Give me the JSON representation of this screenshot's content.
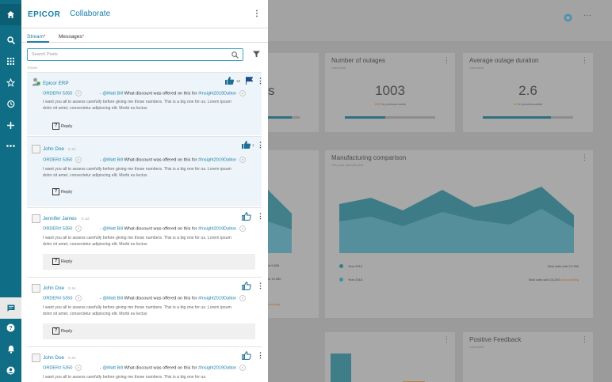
{
  "header": {
    "brand": "EPICOR",
    "title": "Collaborate"
  },
  "tabs": [
    {
      "label": "Stream",
      "marker": "*"
    },
    {
      "label": "Messages",
      "marker": "*"
    }
  ],
  "search": {
    "placeholder": "Search Posts"
  },
  "today_label": "TODAY",
  "rail": {
    "top": [
      "home-icon",
      "search-icon",
      "apps-icon",
      "star-icon",
      "history-icon",
      "plus-icon",
      "more-icon"
    ],
    "bottom": [
      "chat-icon",
      "help-icon",
      "bell-icon",
      "account-icon"
    ]
  },
  "posts": [
    {
      "author": "Epicor ERP",
      "date": "",
      "order": "ORDER# 5350",
      "mention": "@Matt Bill",
      "message": "What discount was offered on this for",
      "tag": "#Insight2019Dalton",
      "body": "I want you all to assess carefully before giving me those numbers. This is a big one for us. Lorem ipsum dolor sit amet, consectetur adipiscing elit. Morbi eu lectus",
      "reply": "Reply",
      "likes": "19",
      "liked": true,
      "flagged": true
    },
    {
      "author": "John Doe",
      "date": "9 Jul",
      "order": "ORDER# 5350",
      "mention": "@Matt Bill",
      "message": "What discount was offered on this for",
      "tag": "#Insight2019Dalton",
      "body": "I want you all to assess carefully before giving me those numbers. This is a big one for us. Lorem ipsum dolor sit amet, consectetur adipiscing elit. Morbi eu lectus",
      "reply": "Reply",
      "likes": "1",
      "liked": true,
      "flagged": false
    },
    {
      "author": "Jennifer James",
      "date": "9 Jul",
      "order": "ORDER# 5350",
      "mention": "@Matt Bill",
      "message": "What discount was offered on this for",
      "tag": "#Insight2019Dalton",
      "body": "I want you all to assess carefully before giving me those numbers. This is a big one for us. Lorem ipsum dolor sit amet, consectetur adipiscing elit. Morbi eu lectus",
      "reply": "Reply",
      "likes": "",
      "liked": false,
      "flagged": false
    },
    {
      "author": "John Doe",
      "date": "9 Jul",
      "order": "ORDER# 5350",
      "mention": "@Matt Bill",
      "message": "What discount was offered on this for",
      "tag": "#Insight2019Dalton",
      "body": "I want you all to assess carefully before giving me those numbers. This is a big one for us. Lorem ipsum dolor sit amet, consectetur adipiscing elit. Morbi eu lectus",
      "reply": "Reply",
      "likes": "",
      "liked": false,
      "flagged": false
    },
    {
      "author": "John Doe",
      "date": "9 Jul",
      "order": "ORDER# 5350",
      "mention": "@Matt Bill",
      "message": "What discount was offered on this for",
      "tag": "#Insight2019Dalton",
      "body": "I want you all to assess carefully before giving me those numbers. This is a big one for us.",
      "reply": "",
      "likes": "",
      "liked": false,
      "flagged": false
    }
  ],
  "background": {
    "cards": [
      {
        "title": "Number of outages",
        "subtitle": "Last week",
        "value": "1003",
        "compare_value": "1005",
        "compare_text": "in previous week",
        "progress": 0.45
      },
      {
        "title": "Average outage duration",
        "subtitle": "Last week",
        "value": "2.6",
        "compare_value": "8.5",
        "compare_text": "in previous week",
        "progress": 0.75
      }
    ],
    "chart": {
      "title": "Manufacturing comparison",
      "subtitle": "This year and last year",
      "legend": [
        {
          "label": "Year 2019",
          "color": "#2e7f88",
          "total_label": "Total units sold",
          "total": "12,250",
          "extra": ""
        },
        {
          "label": "Year 2018",
          "color": "#3f8fa8",
          "total_label": "Total units sold",
          "total": "16,200",
          "extra": "and counting"
        }
      ],
      "partial_left": [
        "s",
        "ld 9,856",
        "ld 15,980",
        "counting"
      ]
    },
    "positive_feedback": {
      "title": "Positive Feedback",
      "subtitle": "Last week"
    },
    "colors": {
      "accent": "#1a7fa8",
      "rail": "#0f6e85",
      "flag": "#1f4f8a"
    }
  }
}
